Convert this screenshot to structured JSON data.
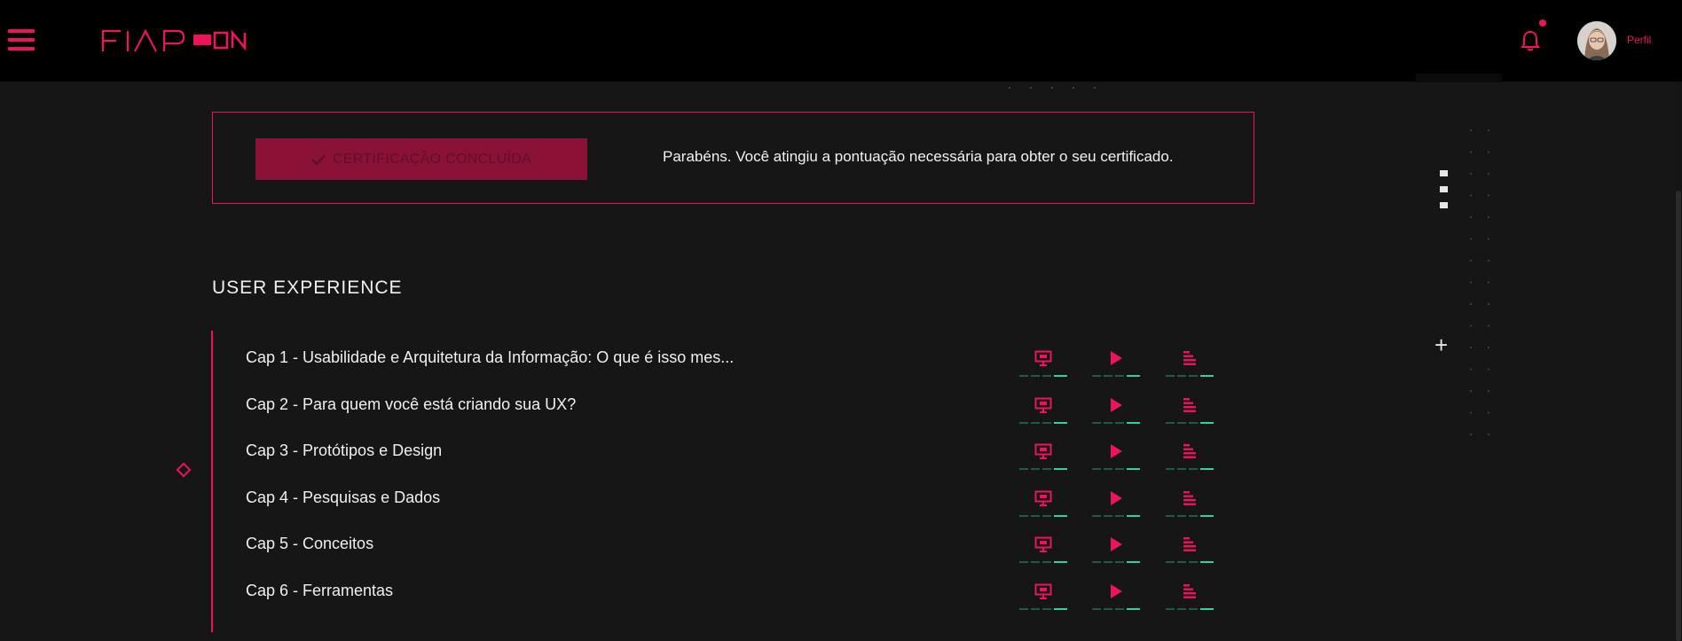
{
  "header": {
    "profile_label": "Perfil"
  },
  "certificate": {
    "button_label": "CERTIFICAÇÃO CONCLUÍDA",
    "message": "Parabéns. Você atingiu a pontuação necessária para obter o seu certificado."
  },
  "course": {
    "title": "USER EXPERIENCE",
    "chapters": [
      {
        "label": "Cap 1 - Usabilidade e Arquitetura da Informação: O que é isso mes..."
      },
      {
        "label": "Cap 2 - Para quem você está criando sua UX?"
      },
      {
        "label": "Cap 3 - Protótipos e Design"
      },
      {
        "label": "Cap 4 - Pesquisas e Dados"
      },
      {
        "label": "Cap 5 - Conceitos"
      },
      {
        "label": "Cap 6 - Ferramentas"
      }
    ]
  },
  "icons": {
    "menu": "hamburger-icon",
    "notifications": "bell-icon",
    "more": "kebab-icon",
    "expand": "plus-icon",
    "chapter_actions": [
      "presentation-icon",
      "play-icon",
      "text-icon"
    ]
  },
  "colors": {
    "accent": "#ed145b",
    "background": "#161616",
    "topbar": "#000000",
    "progress_done": "#2fd1a0",
    "progress_todo": "#1f5c47"
  }
}
